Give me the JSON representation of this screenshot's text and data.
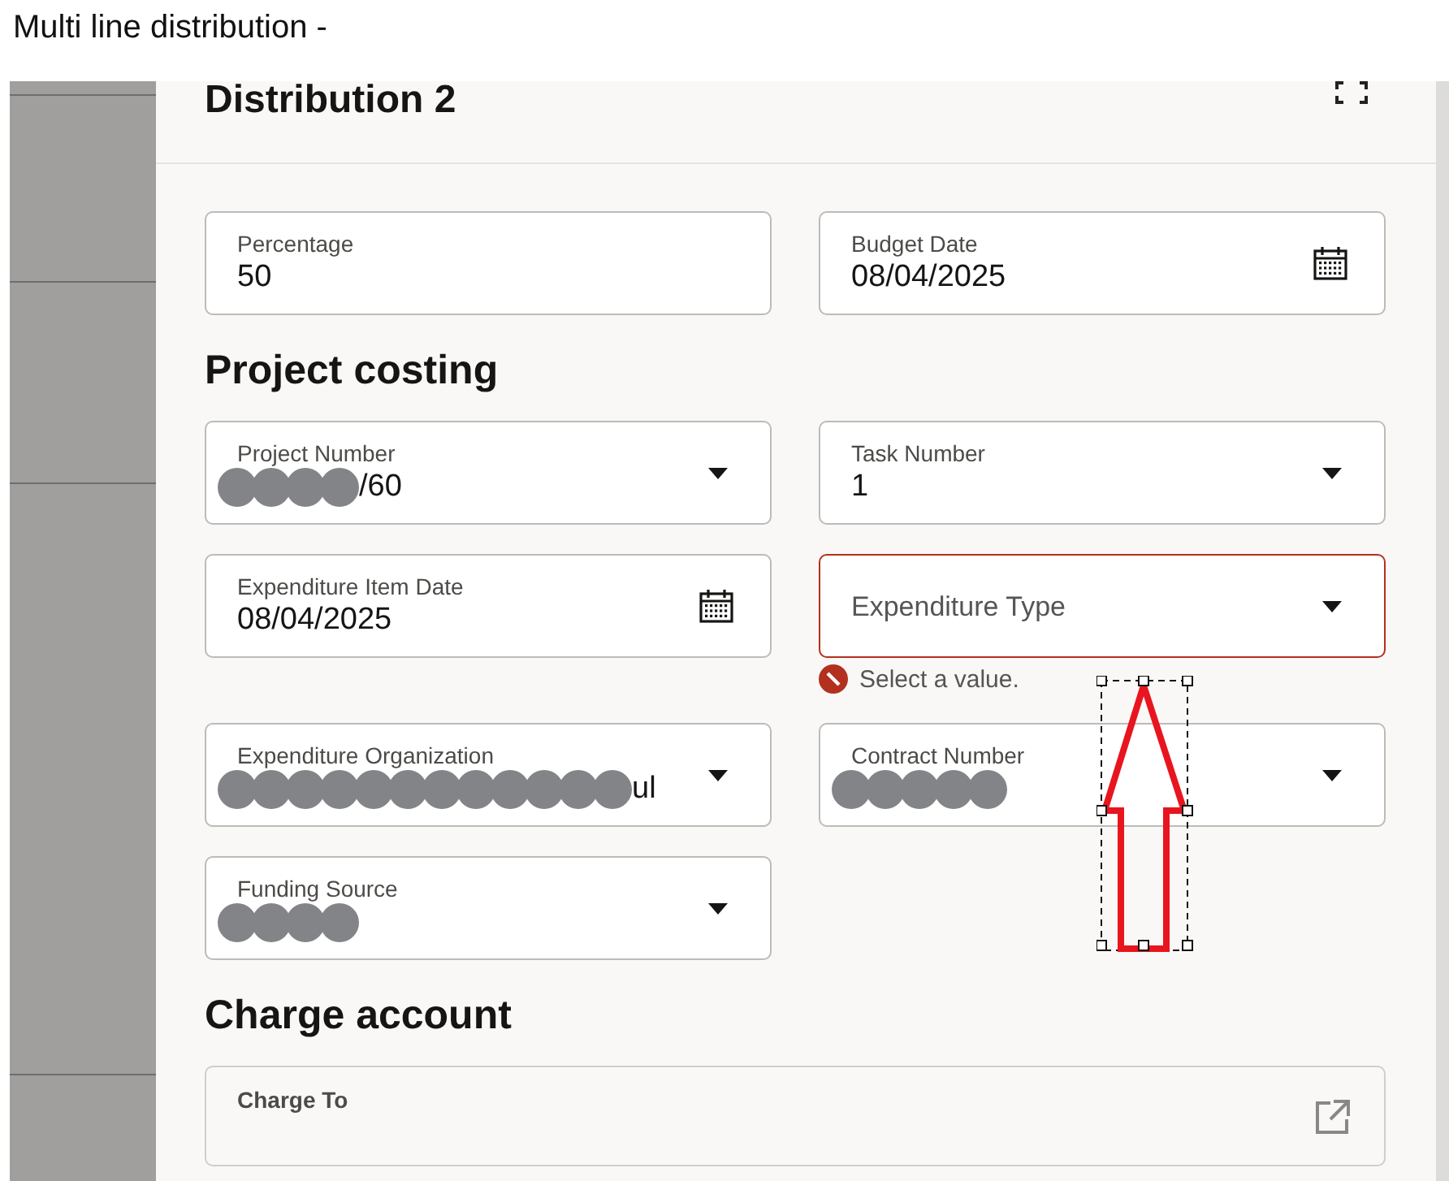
{
  "page_title": "Multi line distribution -",
  "panel": {
    "title": "Distribution 2"
  },
  "top_fields": [
    {
      "kind": "text",
      "label": "Percentage",
      "value": "50"
    },
    {
      "kind": "date",
      "label": "Budget Date",
      "value": "08/04/2025"
    }
  ],
  "sections": [
    {
      "title": "Project costing",
      "fields": [
        {
          "kind": "select",
          "label": "Project Number",
          "value": "/60",
          "redacted": true
        },
        {
          "kind": "select",
          "label": "Task Number",
          "value": "1"
        },
        {
          "kind": "date",
          "label": "Expenditure Item Date",
          "value": "08/04/2025"
        },
        {
          "kind": "select",
          "label": "Expenditure Type",
          "invalid": true,
          "message": "Select a value."
        },
        {
          "kind": "select",
          "label": "Expenditure Organization",
          "value": "ul",
          "redacted": true
        },
        {
          "kind": "select",
          "label": "Contract Number",
          "redacted": true
        },
        {
          "kind": "select",
          "label": "Funding Source",
          "redacted": true
        }
      ]
    },
    {
      "title": "Charge account",
      "fields": [
        {
          "kind": "link",
          "label": "Charge To"
        }
      ]
    }
  ]
}
